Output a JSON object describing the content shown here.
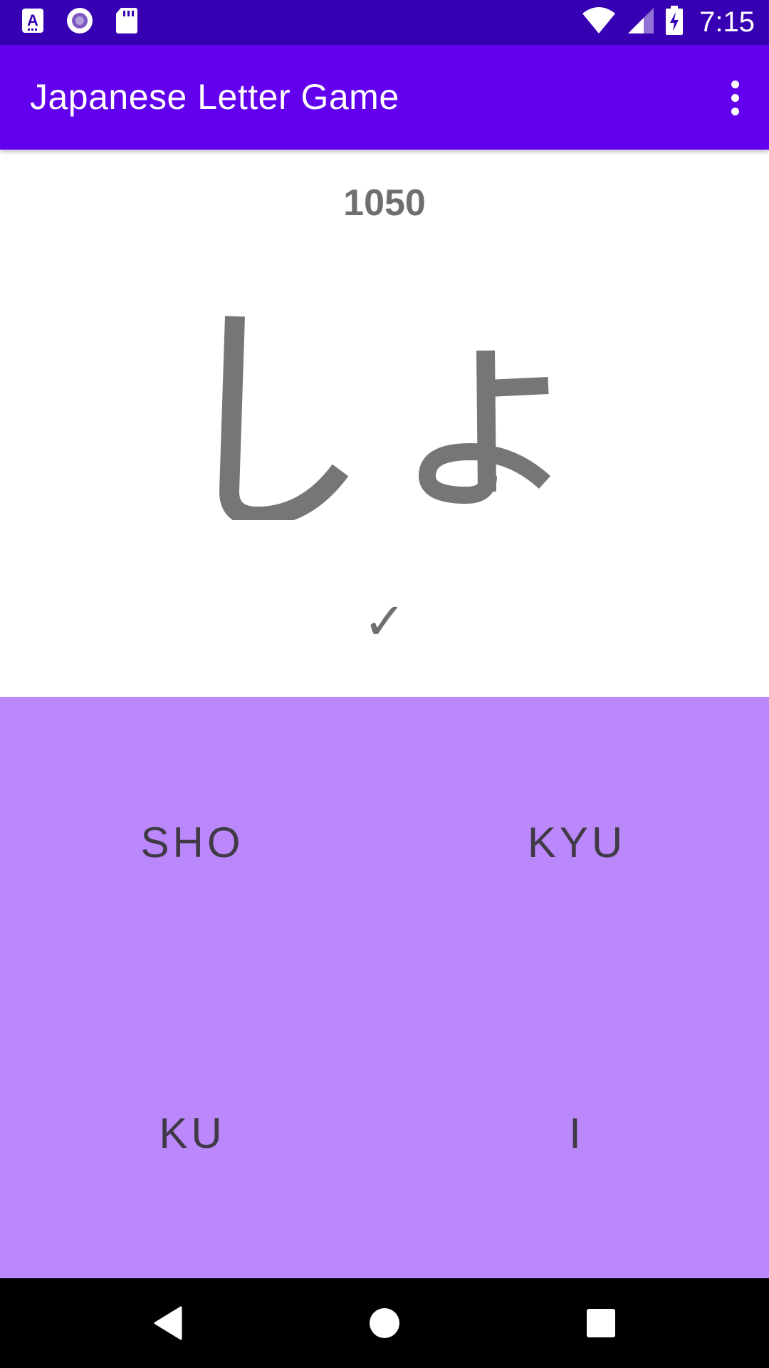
{
  "status_bar": {
    "time": "7:15",
    "left_icons": [
      "keyboard-a-icon",
      "record-circle-icon",
      "sd-card-icon"
    ],
    "right_icons": [
      "wifi-icon",
      "cell-signal-icon",
      "battery-charging-icon"
    ]
  },
  "app_bar": {
    "title": "Japanese Letter Game",
    "menu_icon": "overflow-menu-icon"
  },
  "game": {
    "score": "1050",
    "kana": "しょ",
    "feedback": "✓"
  },
  "answers": [
    {
      "label": "SHO"
    },
    {
      "label": "KYU"
    },
    {
      "label": "KU"
    },
    {
      "label": "I"
    }
  ],
  "nav_bar": {
    "icons": [
      "back-icon",
      "home-icon",
      "recents-icon"
    ]
  },
  "colors": {
    "status_bar": "#3700b3",
    "app_bar": "#6200ee",
    "answer_area": "#bb88fb",
    "text_gray": "#6f6f6f",
    "answer_text": "#3f3a45"
  }
}
